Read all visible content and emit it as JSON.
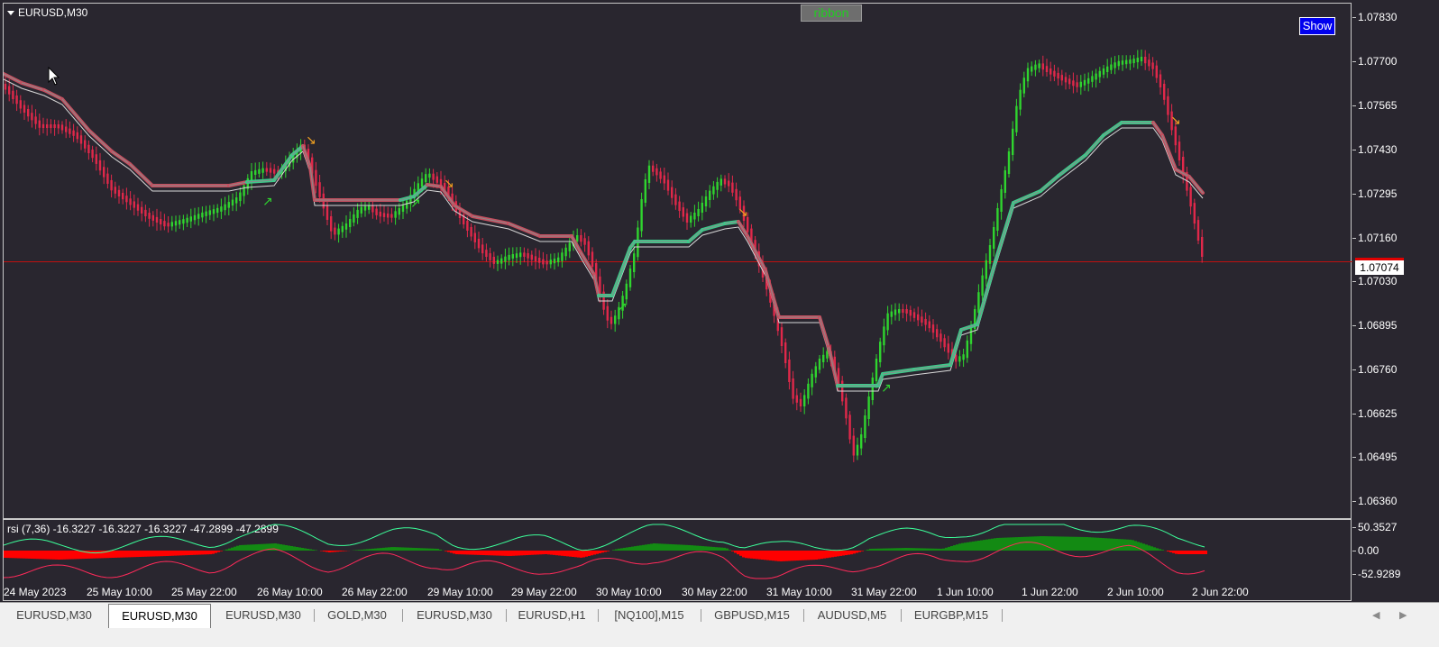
{
  "window": {
    "symbol_title": "EURUSD,M30",
    "ribbon_button": "ribbon",
    "show_button": "Show"
  },
  "price_axis": {
    "ticks": [
      "1.07830",
      "1.07700",
      "1.07565",
      "1.07430",
      "1.07295",
      "1.07160",
      "1.07030",
      "1.06895",
      "1.06760",
      "1.06625",
      "1.06495",
      "1.06360"
    ],
    "current_price": "1.07074"
  },
  "rsi_panel": {
    "label": "rsi (7,36) -16.3227 -16.3227 -16.3227 -47.2899 -47.2899",
    "ticks": [
      "50.3527",
      "0.00",
      "-52.9289"
    ]
  },
  "time_axis": {
    "ticks": [
      "24 May 2023",
      "25 May 10:00",
      "25 May 22:00",
      "26 May 10:00",
      "26 May 22:00",
      "29 May 10:00",
      "29 May 22:00",
      "30 May 10:00",
      "30 May 22:00",
      "31 May 10:00",
      "31 May 22:00",
      "1 Jun 10:00",
      "1 Jun 22:00",
      "2 Jun 10:00",
      "2 Jun 22:00"
    ]
  },
  "tabs": [
    {
      "label": "EURUSD,M30"
    },
    {
      "label": "EURUSD,M30"
    },
    {
      "label": "EURUSD,M30"
    },
    {
      "label": "GOLD,M30"
    },
    {
      "label": "EURUSD,M30"
    },
    {
      "label": "EURUSD,H1"
    },
    {
      "label": "[NQ100],M15"
    },
    {
      "label": "GBPUSD,M15"
    },
    {
      "label": "AUDUSD,M5"
    },
    {
      "label": "EURGBP,M15"
    }
  ],
  "colors": {
    "background": "#29262f",
    "bull": "#2fd42f",
    "bear": "#e0284a",
    "ribbon_up": "#3ec98a",
    "ribbon_down": "#c45060",
    "arrow": "#f0a020",
    "rsi_fill_pos": "#138a13",
    "rsi_fill_neg": "#ff0000",
    "rsi_line_up": "#3cff9a",
    "rsi_line_down": "#ff2a5a",
    "current_price_line": "#c01010"
  },
  "chart_data": {
    "type": "candlestick",
    "symbol": "EURUSD",
    "timeframe": "M30",
    "ylim": [
      1.0636,
      1.0783
    ],
    "current_price": 1.07074,
    "x": [
      "24 May 2023",
      "25 May 10:00",
      "25 May 22:00",
      "26 May 10:00",
      "26 May 22:00",
      "29 May 10:00",
      "29 May 22:00",
      "30 May 10:00",
      "30 May 22:00",
      "31 May 10:00",
      "31 May 22:00",
      "1 Jun 10:00",
      "1 Jun 22:00",
      "2 Jun 10:00",
      "2 Jun 22:00"
    ],
    "close_approx": [
      1.0762,
      1.0738,
      1.072,
      1.0743,
      1.0712,
      1.0738,
      1.0708,
      1.0714,
      1.0735,
      1.07,
      1.0658,
      1.07,
      1.0768,
      1.0769,
      1.0705
    ],
    "rsi": {
      "ylim": [
        -52.9289,
        50.3527
      ]
    }
  }
}
